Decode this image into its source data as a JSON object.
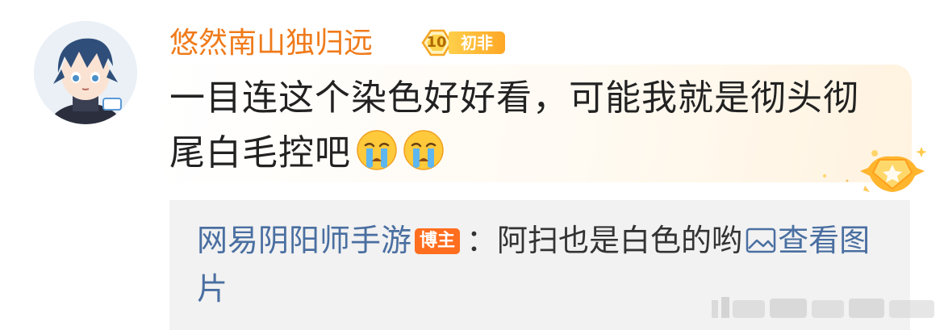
{
  "user": {
    "name": "悠然南山独归远",
    "level": "10",
    "level_tag": "初非",
    "avatar": "anime-avatar"
  },
  "comment": {
    "line1": "一目连这个染色好好看，可能我就是彻头彻",
    "line2": "尾白毛控吧",
    "emojis": [
      "crying-emoji",
      "crying-emoji"
    ]
  },
  "reply": {
    "user": "网易阴阳师手游",
    "host_badge": "博主",
    "separator": "：",
    "text": "阿扫也是白色的哟",
    "link_icon": "picture-icon",
    "link_text": "查看图片"
  },
  "colors": {
    "username": "#ef7b1b",
    "reply_user": "#4a6fa1",
    "host_badge": "#ff6e1f",
    "reply_bg": "#f2f2f2"
  }
}
